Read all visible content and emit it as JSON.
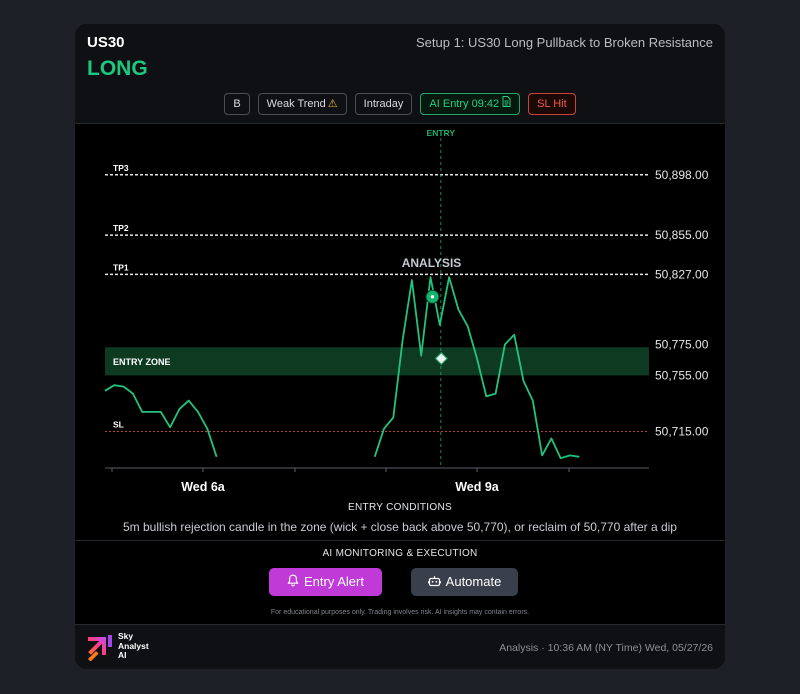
{
  "header": {
    "symbol": "US30",
    "setup_title": "Setup 1: US30 Long Pullback to Broken Resistance",
    "direction": "LONG",
    "badges": {
      "grade": "B",
      "trend": "Weak Trend",
      "timeframe": "Intraday",
      "ai_entry": "AI Entry 09:42",
      "sl_hit": "SL Hit"
    }
  },
  "chart_data": {
    "type": "line",
    "x_ticks": [
      "Wed 6a",
      "Wed 9a"
    ],
    "levels": [
      {
        "key": "tp3",
        "label": "TP3",
        "price": 50898,
        "price_label": "50,898.00"
      },
      {
        "key": "tp2",
        "label": "TP2",
        "price": 50855,
        "price_label": "50,855.00"
      },
      {
        "key": "tp1",
        "label": "TP1",
        "price": 50827,
        "price_label": "50,827.00"
      },
      {
        "key": "zone_top",
        "label": "",
        "price": 50775,
        "price_label": "50,775.00"
      },
      {
        "key": "zone_bottom",
        "label": "",
        "price": 50755,
        "price_label": "50,755.00"
      },
      {
        "key": "sl",
        "label": "SL",
        "price": 50715,
        "price_label": "50,715.00"
      }
    ],
    "entry_zone": {
      "label": "ENTRY ZONE",
      "low": 50755,
      "high": 50775
    },
    "entry_marker": {
      "label": "ENTRY",
      "index": 36
    },
    "analysis_marker": {
      "label": "ANALYSIS",
      "index": 35,
      "price": 50811
    },
    "entry_point": {
      "index": 36,
      "price": 50767
    },
    "segments": [
      {
        "start": 0,
        "values": [
          50744,
          50748,
          50747,
          50742,
          50729,
          50729,
          50729,
          50718,
          50731,
          50737,
          50729,
          50717,
          50697
        ]
      },
      {
        "start": 29,
        "values": [
          50697,
          50717,
          50725,
          50780,
          50823,
          50769,
          50825,
          50791,
          50825,
          50802,
          50790,
          50767,
          50740,
          50742,
          50777,
          50784,
          50751,
          50737,
          50698,
          50710,
          50696,
          50698,
          50697
        ]
      }
    ],
    "colors": {
      "line": "#22c47d",
      "zone": "#0e3a22",
      "sl": "#b2473d",
      "tp": "#e6e6e6",
      "entry": "#1fae6a"
    }
  },
  "conditions": {
    "title": "ENTRY CONDITIONS",
    "text": "5m bullish rejection candle in the zone (wick + close back above 50,770), or reclaim of 50,770 after a dip"
  },
  "monitoring": {
    "title": "AI MONITORING & EXECUTION",
    "entry_alert": "Entry Alert",
    "automate": "Automate"
  },
  "disclaimer": "For educational purposes only. Trading involves risk. AI insights may contain errors.",
  "footer": {
    "logo_line1": "Sky",
    "logo_line2": "Analyst",
    "logo_line3": "AI",
    "analysis_time": "Analysis · 10:36 AM (NY Time) Wed, 05/27/26"
  },
  "icons": {
    "trend": "warning-icon",
    "ai_entry": "document-icon",
    "entry_alert": "bell-icon",
    "automate": "robot-icon"
  }
}
